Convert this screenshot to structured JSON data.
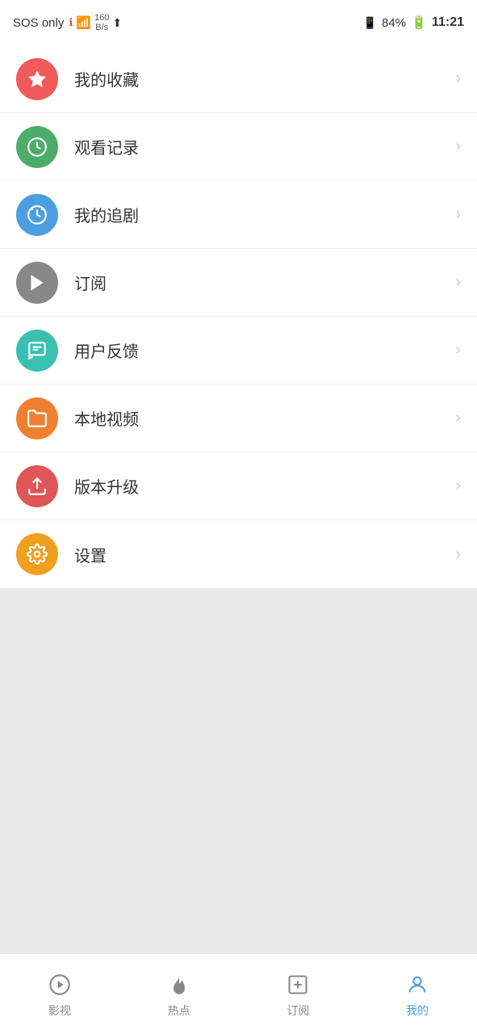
{
  "statusBar": {
    "sosText": "SOS only",
    "networkSpeed": "160\nB/s",
    "batteryPercent": "84%",
    "time": "11:21"
  },
  "menuItems": [
    {
      "id": "favorites",
      "label": "我的收藏",
      "iconColor": "icon-red",
      "iconSymbol": "★"
    },
    {
      "id": "history",
      "label": "观看记录",
      "iconColor": "icon-green",
      "iconSymbol": "⏱"
    },
    {
      "id": "following",
      "label": "我的追剧",
      "iconColor": "icon-blue",
      "iconSymbol": "⏰"
    },
    {
      "id": "subscription",
      "label": "订阅",
      "iconColor": "icon-gray",
      "iconSymbol": "▶"
    },
    {
      "id": "feedback",
      "label": "用户反馈",
      "iconColor": "icon-teal",
      "iconSymbol": "💬"
    },
    {
      "id": "local-video",
      "label": "本地视频",
      "iconColor": "icon-orange",
      "iconSymbol": "📁"
    },
    {
      "id": "update",
      "label": "版本升级",
      "iconColor": "icon-red-multi",
      "iconSymbol": "⊕"
    },
    {
      "id": "settings",
      "label": "设置",
      "iconColor": "icon-gold",
      "iconSymbol": "⚙"
    }
  ],
  "bottomNav": [
    {
      "id": "videos",
      "label": "影视",
      "active": false
    },
    {
      "id": "hot",
      "label": "热点",
      "active": false
    },
    {
      "id": "subscribe",
      "label": "订阅",
      "active": false
    },
    {
      "id": "mine",
      "label": "我的",
      "active": true
    }
  ]
}
